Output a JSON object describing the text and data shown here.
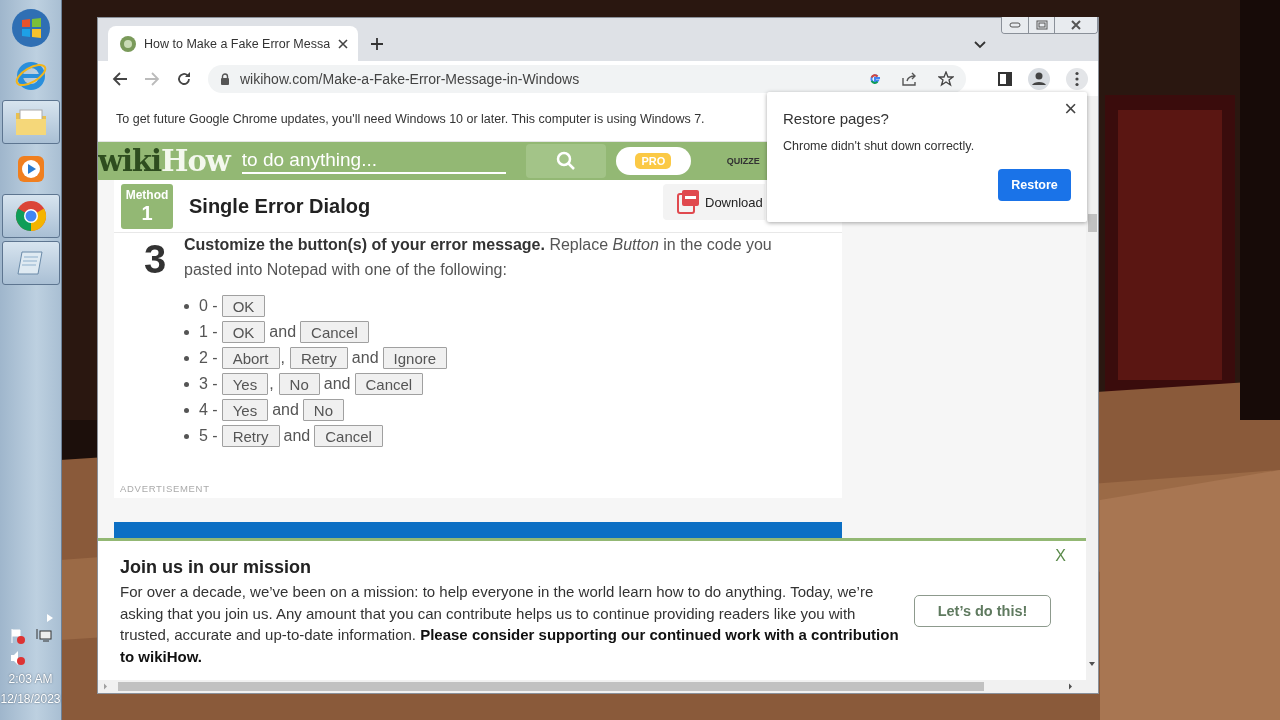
{
  "taskbar": {
    "items": [
      {
        "kind": "start",
        "active": false
      },
      {
        "kind": "ie",
        "active": false
      },
      {
        "kind": "explorer",
        "active": true
      },
      {
        "kind": "media",
        "active": false
      },
      {
        "kind": "chrome",
        "active": true
      },
      {
        "kind": "notepad",
        "active": true
      }
    ],
    "clock": {
      "time": "2:03 AM",
      "date": "12/18/2023"
    }
  },
  "browser": {
    "tab": {
      "title": "How to Make a Fake Error Messa"
    },
    "url": "wikihow.com/Make-a-Fake-Error-Message-in-Windows",
    "infobar": "To get future Google Chrome updates, you'll need Windows 10 or later. This computer is using Windows 7."
  },
  "header": {
    "logo_wiki": "wiki",
    "logo_how": "How",
    "search_placeholder": "to do anything...",
    "pro": "PRO",
    "nav": "QUIZZE"
  },
  "method": {
    "label": "Method",
    "number": "1",
    "title": "Single Error Dialog",
    "download": "Download"
  },
  "step": {
    "number": "3",
    "text": "**Customize the button(s) of your error message.** Replace *Button* in the code you pasted into Notepad with one of the following:"
  },
  "options": [
    {
      "code": "0 -",
      "parts": [
        {
          "kind": "button",
          "text": "OK"
        }
      ]
    },
    {
      "code": "1 -",
      "parts": [
        {
          "kind": "button",
          "text": "OK"
        },
        {
          "kind": "text",
          "text": "and"
        },
        {
          "kind": "button",
          "text": "Cancel"
        }
      ]
    },
    {
      "code": "2 -",
      "parts": [
        {
          "kind": "button",
          "text": "Abort"
        },
        {
          "kind": "comma",
          "text": ","
        },
        {
          "kind": "button",
          "text": "Retry"
        },
        {
          "kind": "text",
          "text": "and"
        },
        {
          "kind": "button",
          "text": "Ignore"
        }
      ]
    },
    {
      "code": "3 -",
      "parts": [
        {
          "kind": "button",
          "text": "Yes"
        },
        {
          "kind": "comma",
          "text": ","
        },
        {
          "kind": "button",
          "text": "No"
        },
        {
          "kind": "text",
          "text": "and"
        },
        {
          "kind": "button",
          "text": "Cancel"
        }
      ]
    },
    {
      "code": "4 -",
      "parts": [
        {
          "kind": "button",
          "text": "Yes"
        },
        {
          "kind": "text",
          "text": "and"
        },
        {
          "kind": "button",
          "text": "No"
        }
      ]
    },
    {
      "code": "5 -",
      "parts": [
        {
          "kind": "button",
          "text": "Retry"
        },
        {
          "kind": "text",
          "text": "and"
        },
        {
          "kind": "button",
          "text": "Cancel"
        }
      ]
    }
  ],
  "ad_label": "ADVERTISEMENT",
  "mission": {
    "title": "Join us in our mission",
    "body": "For over a decade, we’ve been on a mission: to help everyone in the world learn how to do anything. Today, we’re asking that you join us. Any amount that you can contribute helps us to continue providing readers like you with trusted, accurate and up-to-date information. **Please consider supporting our continued work with a contribution to wikiHow.**",
    "close": "X",
    "button": "Let’s do this!"
  },
  "popup": {
    "title": "Restore pages?",
    "message": "Chrome didn't shut down correctly.",
    "close": "×",
    "button": "Restore"
  }
}
